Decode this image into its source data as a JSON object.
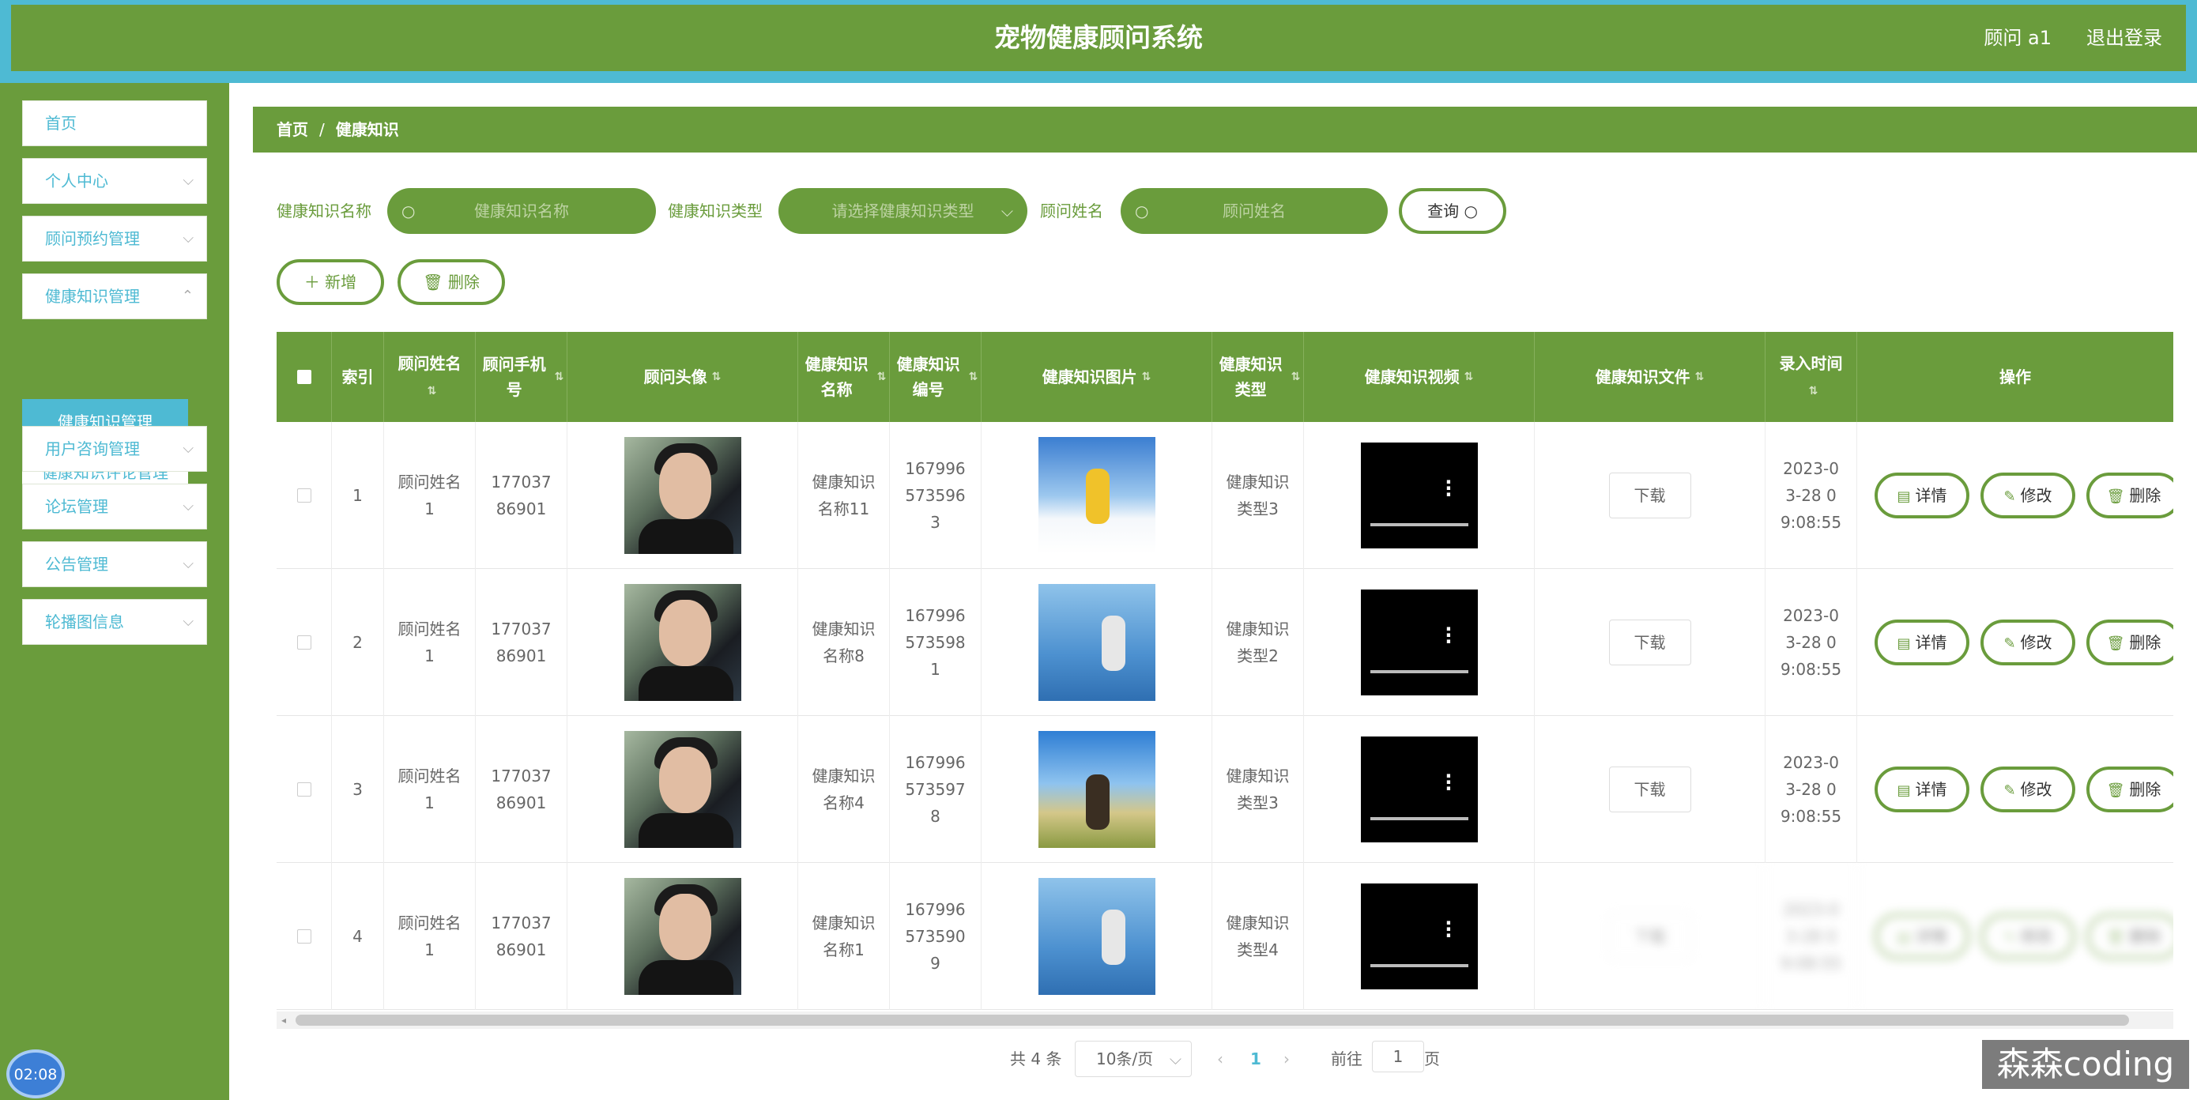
{
  "header": {
    "title": "宠物健康顾问系统",
    "user": "顾问 a1",
    "logout": "退出登录"
  },
  "sidebar": {
    "items": [
      {
        "label": "首页"
      },
      {
        "label": "个人中心"
      },
      {
        "label": "顾问预约管理"
      },
      {
        "label": "健康知识管理"
      },
      {
        "label": "用户咨询管理"
      },
      {
        "label": "论坛管理"
      },
      {
        "label": "公告管理"
      },
      {
        "label": "轮播图信息"
      }
    ],
    "submenu": {
      "active": "健康知识管理",
      "other": "健康知识评论管理"
    },
    "timer": "02:08"
  },
  "breadcrumb": {
    "home": "首页",
    "sep": "/",
    "current": "健康知识"
  },
  "search": {
    "name_label": "健康知识名称",
    "name_placeholder": "健康知识名称",
    "type_label": "健康知识类型",
    "type_placeholder": "请选择健康知识类型",
    "advisor_label": "顾问姓名",
    "advisor_placeholder": "顾问姓名",
    "query": "查询"
  },
  "toolbar": {
    "add": "新增",
    "delete": "删除"
  },
  "table": {
    "headers": [
      "索引",
      "顾问姓名",
      "顾问手机号",
      "顾问头像",
      "健康知识名称",
      "健康知识编号",
      "健康知识图片",
      "健康知识类型",
      "健康知识视频",
      "健康知识文件",
      "录入时间",
      "操作"
    ],
    "rows": [
      {
        "index": "1",
        "advisor": "顾问姓名1",
        "phone": "17703786901",
        "name": "健康知识名称11",
        "code": "1679965735963",
        "type": "健康知识类型3",
        "file": "下载",
        "time": "2023-03-28 09:08:55",
        "pic": "ski"
      },
      {
        "index": "2",
        "advisor": "顾问姓名1",
        "phone": "17703786901",
        "name": "健康知识名称8",
        "code": "1679965735981",
        "type": "健康知识类型2",
        "file": "下载",
        "time": "2023-03-28 09:08:55",
        "pic": "run"
      },
      {
        "index": "3",
        "advisor": "顾问姓名1",
        "phone": "17703786901",
        "name": "健康知识名称4",
        "code": "1679965735978",
        "type": "健康知识类型3",
        "file": "下载",
        "time": "2023-03-28 09:08:55",
        "pic": "bike"
      },
      {
        "index": "4",
        "advisor": "顾问姓名1",
        "phone": "17703786901",
        "name": "健康知识名称1",
        "code": "1679965735909",
        "type": "健康知识类型4",
        "file": "下载",
        "time": "2023-03-28 09:08:55",
        "pic": "run"
      }
    ],
    "actions": {
      "detail": "详情",
      "edit": "修改",
      "delete": "删除"
    }
  },
  "pagination": {
    "total": "共 4 条",
    "page_size": "10条/页",
    "current": "1",
    "goto": "前往",
    "goto_value": "1",
    "page_unit": "页"
  },
  "watermark": "森森coding",
  "colors": {
    "primary": "#6a9c3c",
    "accent": "#4ebad3"
  }
}
